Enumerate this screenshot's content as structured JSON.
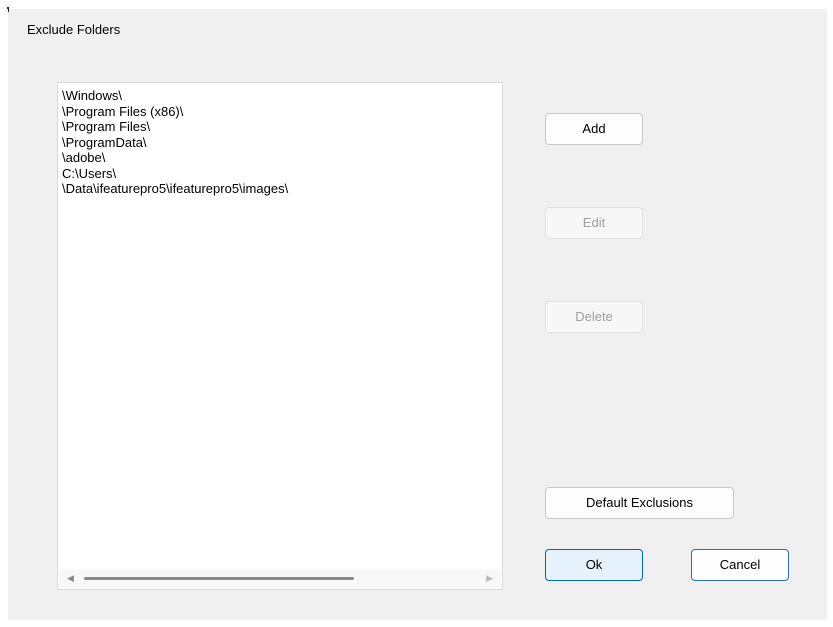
{
  "dialog": {
    "title": "Exclude Folders"
  },
  "folder_list": {
    "items": [
      "\\Windows\\",
      "\\Program Files (x86)\\",
      "\\Program Files\\",
      "\\ProgramData\\",
      "\\adobe\\",
      "C:\\Users\\",
      "\\Data\\ifeaturepro5\\ifeaturepro5\\images\\"
    ]
  },
  "buttons": {
    "add": "Add",
    "edit": "Edit",
    "delete": "Delete",
    "default_exclusions": "Default Exclusions",
    "ok": "Ok",
    "cancel": "Cancel"
  },
  "scrollbar": {
    "left_arrow": "◀",
    "right_arrow": "▶"
  },
  "colors": {
    "primary_border": "#0067c0",
    "primary_fill": "#e5f1fb",
    "disabled_text": "#9e9e9e"
  }
}
